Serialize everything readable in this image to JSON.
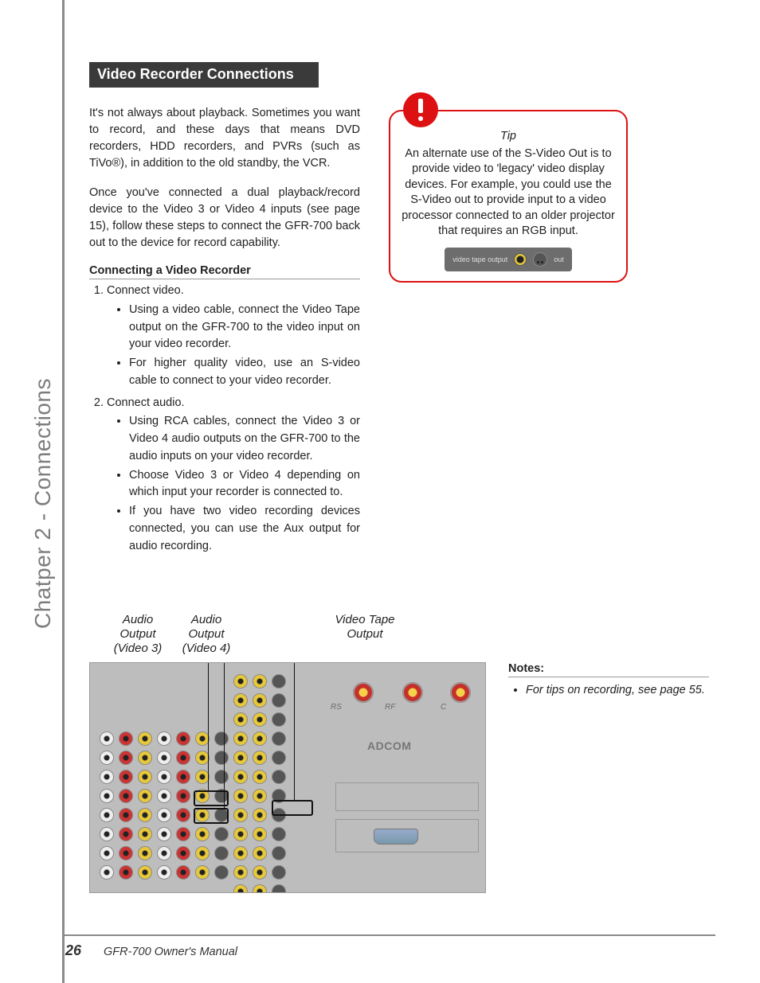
{
  "side_tab": "Chatper 2 - Connections",
  "section_title": "Video Recorder Connections",
  "intro_p1": "It's not always about playback. Sometimes you want to record, and these days that means DVD recorders, HDD recorders, and PVRs (such as TiVo®), in addition to the old standby, the VCR.",
  "intro_p2": "Once you've connected a dual playback/record device to the Video 3 or Video 4 inputs (see page 15), follow these steps to connect the GFR-700 back out to the device for record capability.",
  "subhead": "Connecting a Video Recorder",
  "steps": {
    "s1": "Connect video.",
    "s1_bullets": [
      "Using a video cable, connect the Video Tape output on the GFR-700 to the video input on your video recorder.",
      "For higher quality video, use an S-video cable to connect to your video recorder."
    ],
    "s2": "Connect audio.",
    "s2_bullets": [
      "Using RCA cables, connect the Video 3 or Video 4 audio outputs  on the GFR-700 to the audio inputs on your video recorder.",
      "Choose Video 3 or Video 4 depending on which input your recorder is connected to.",
      "If you have two video recording devices connected, you can use the Aux output for audio recording."
    ]
  },
  "tip": {
    "title": "Tip",
    "body": "An alternate use of the S-Video Out is to provide video to 'legacy' video display devices. For example, you could use the S-Video out to provide input to a video processor connected to an older projector that requires an RGB input.",
    "panel_left": "video tape output",
    "panel_right": "out"
  },
  "diagram": {
    "callout_1": "Audio Output (Video 3)",
    "callout_2": "Audio Output (Video 4)",
    "callout_3": "Video Tape Output",
    "labels": {
      "rs": "RS",
      "rf": "RF",
      "c": "C",
      "brand": "ADCOM"
    }
  },
  "notes": {
    "head": "Notes:",
    "items": [
      "For tips on recording, see page 55."
    ]
  },
  "footer": {
    "page": "26",
    "manual": "GFR-700 Owner's Manual"
  }
}
